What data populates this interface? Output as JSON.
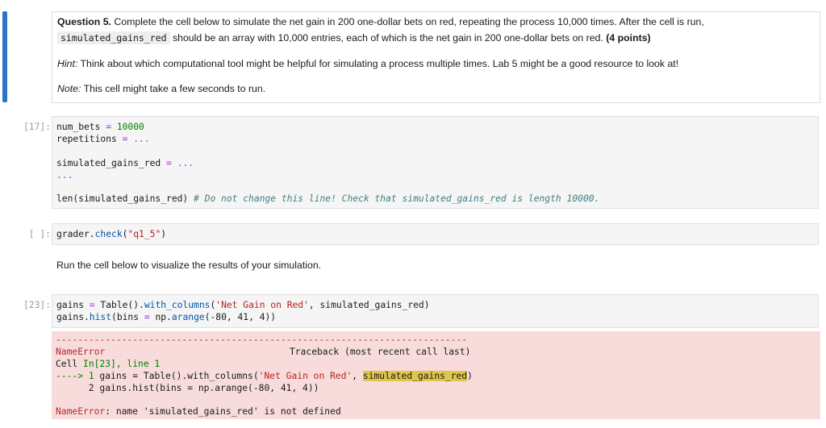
{
  "markdown": {
    "question_label": "Question 5.",
    "line1": " Complete the cell below to simulate the net gain in 200 one-dollar bets on red, repeating the process 10,000 times. After the cell is run,",
    "line2_code": "simulated_gains_red",
    "line2_text": " should be an array with 10,000 entries, each of which is the net gain in 200 one-dollar bets on red. ",
    "points": "(4 points)",
    "hint_label": "Hint:",
    "hint_text": " Think about which computational tool might be helpful for simulating a process multiple times. Lab 5 might be a good resource to look at!",
    "note_label": "Note:",
    "note_text": " This cell might take a few seconds to run."
  },
  "cell17": {
    "prompt": "[17]:",
    "l1_a": "num_bets ",
    "l1_op": "=",
    "l1_num": " 10000",
    "l2_a": "repetitions ",
    "l2_op": "=",
    "l2_rest": " ...",
    "l3_a": "simulated_gains_red ",
    "l3_op": "=",
    "l3_rest": " ...",
    "l4": "...",
    "l5_a": "len(simulated_gains_red) ",
    "l5_comment": "# Do not change this line! Check that simulated_gains_red is length 10000."
  },
  "cell_grader": {
    "prompt": "[ ]:",
    "a": "grader.",
    "fn": "check",
    "b": "(",
    "str": "\"q1_5\"",
    "c": ")"
  },
  "run_text": "Run the cell below to visualize the results of your simulation.",
  "cell23": {
    "prompt": "[23]:",
    "l1_a": "gains ",
    "l1_op": "=",
    "l1_b": " Table().",
    "l1_fn": "with_columns",
    "l1_c": "(",
    "l1_str": "'Net Gain on Red'",
    "l1_d": ", simulated_gains_red)",
    "l2_a": "gains.",
    "l2_fn": "hist",
    "l2_b": "(bins ",
    "l2_op": "=",
    "l2_c": " np.",
    "l2_fn2": "arange",
    "l2_d": "(-80, 41, 4))"
  },
  "error": {
    "dashes": "---------------------------------------------------------------------------",
    "name": "NameError",
    "traceback": "Traceback (most recent call last)",
    "cell_a": "Cell ",
    "cell_b": "In[23], line 1",
    "arrow": "----> ",
    "line1_no": "1",
    "line1_a": " gains = Table().with_columns(",
    "line1_str": "'Net Gain on Red'",
    "line1_b": ", ",
    "line1_hl": "simulated_gains_red",
    "line1_c": ")",
    "line2": "      2 gains.hist(bins = np.arange(-80, 41, 4))",
    "final_name": "NameError",
    "final_msg": ": name 'simulated_gains_red' is not defined"
  }
}
